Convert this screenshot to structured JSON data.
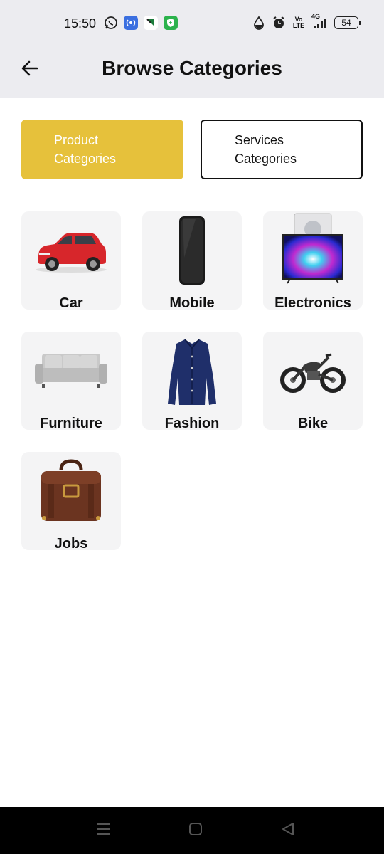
{
  "status_bar": {
    "time": "15:50",
    "battery_level": "54",
    "network": "4G",
    "volte": "Vo LTE",
    "left_icons": [
      "whatsapp-icon",
      "hotspot-icon",
      "notification-icon",
      "shield-icon"
    ],
    "right_icons": [
      "data-saver-icon",
      "alarm-icon",
      "volte-icon",
      "signal-icon",
      "battery-icon"
    ]
  },
  "header": {
    "title": "Browse Categories",
    "back_icon": "arrow-left-icon"
  },
  "tabs": [
    {
      "label": "Product Categories",
      "active": true
    },
    {
      "label": "Services Categories",
      "active": false
    }
  ],
  "categories": [
    {
      "label": "Car",
      "icon": "car-image"
    },
    {
      "label": "Mobile",
      "icon": "mobile-image"
    },
    {
      "label": "Electronics",
      "icon": "electronics-image"
    },
    {
      "label": "Furniture",
      "icon": "furniture-image"
    },
    {
      "label": "Fashion",
      "icon": "fashion-image"
    },
    {
      "label": "Bike",
      "icon": "bike-image"
    },
    {
      "label": "Jobs",
      "icon": "jobs-image"
    }
  ],
  "nav_bar": {
    "items": [
      "menu-icon",
      "home-icon",
      "back-icon"
    ]
  },
  "colors": {
    "accent": "#e6c13b",
    "header_bg": "#ececf0",
    "card_bg": "#f4f4f5"
  }
}
